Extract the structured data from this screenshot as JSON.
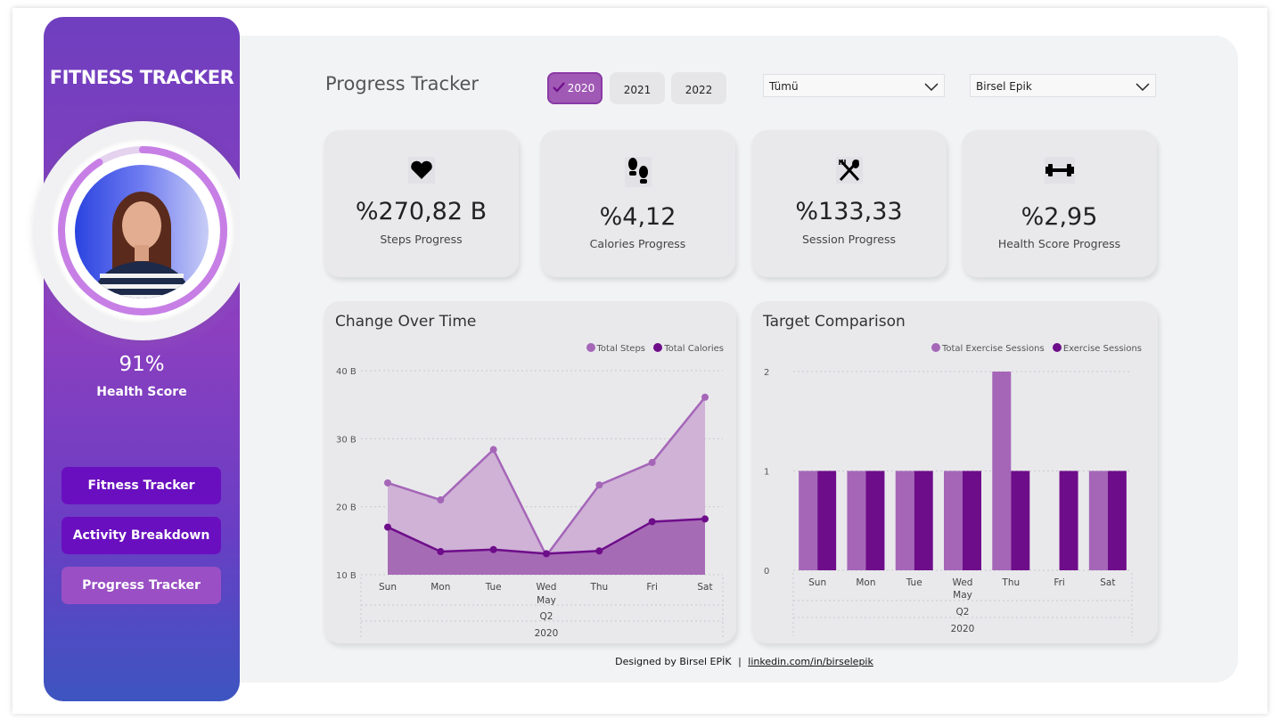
{
  "sidebar": {
    "title": "FITNESS TRACKER",
    "health_score": {
      "value": "91%",
      "label": "Health Score",
      "progress_fraction": 0.91
    },
    "nav": [
      {
        "label": "Fitness Tracker"
      },
      {
        "label": "Activity Breakdown"
      },
      {
        "label": "Progress Tracker",
        "active": true
      }
    ]
  },
  "header": {
    "title": "Progress Tracker",
    "years": [
      {
        "label": "2020",
        "selected": true
      },
      {
        "label": "2021"
      },
      {
        "label": "2022"
      }
    ],
    "filter_1": {
      "value": "Tümü"
    },
    "filter_2": {
      "value": "Birsel Epik"
    }
  },
  "kpis": [
    {
      "icon": "heart-icon",
      "value": "%270,82 B",
      "label": "Steps Progress"
    },
    {
      "icon": "footprints-icon",
      "value": "%4,12",
      "label": "Calories Progress"
    },
    {
      "icon": "utensils-icon",
      "value": "%133,33",
      "label": "Session Progress"
    },
    {
      "icon": "dumbbell-icon",
      "value": "%2,95",
      "label": "Health Score Progress"
    }
  ],
  "colors": {
    "light_purple": "#a566b8",
    "dark_purple": "#6e0d8a",
    "accent": "#7a3fc0"
  },
  "chart_data": [
    {
      "type": "area",
      "title": "Change Over Time",
      "categories": [
        "Sun",
        "Mon",
        "Tue",
        "Wed",
        "Thu",
        "Fri",
        "Sat"
      ],
      "hierarchy_labels": [
        "May",
        "Q2",
        "2020"
      ],
      "y_ticks": [
        "10 B",
        "20 B",
        "30 B",
        "40 B"
      ],
      "ylim": [
        10,
        40
      ],
      "series": [
        {
          "name": "Total Steps",
          "values": [
            23.5,
            21,
            28.4,
            12.8,
            23.2,
            26.5,
            36.1
          ]
        },
        {
          "name": "Total Calories",
          "values": [
            17,
            13.4,
            13.7,
            13.1,
            13.5,
            17.8,
            18.2
          ]
        }
      ],
      "legend": "top-right",
      "grid": true
    },
    {
      "type": "bar",
      "title": "Target Comparison",
      "categories": [
        "Sun",
        "Mon",
        "Tue",
        "Wed",
        "Thu",
        "Fri",
        "Sat"
      ],
      "hierarchy_labels": [
        "May",
        "Q2",
        "2020"
      ],
      "y_ticks": [
        "0",
        "1",
        "2"
      ],
      "ylim": [
        0,
        2
      ],
      "series": [
        {
          "name": "Total Exercise Sessions",
          "values": [
            1,
            1,
            1,
            1,
            2,
            0,
            1
          ]
        },
        {
          "name": "Exercise Sessions",
          "values": [
            1,
            1,
            1,
            1,
            1,
            1,
            1
          ]
        }
      ],
      "legend": "top-right",
      "grid": true
    }
  ],
  "footer": {
    "designed_by": "Designed by Birsel EPİK",
    "separator": "|",
    "link": "linkedin.com/in/birselepik"
  }
}
